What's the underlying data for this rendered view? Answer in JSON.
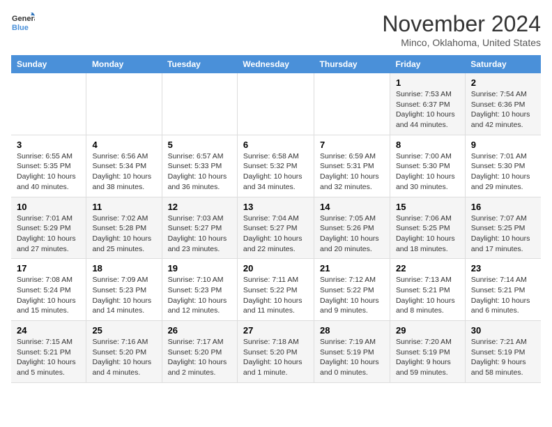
{
  "logo": {
    "general": "General",
    "blue": "Blue"
  },
  "title": "November 2024",
  "location": "Minco, Oklahoma, United States",
  "headers": [
    "Sunday",
    "Monday",
    "Tuesday",
    "Wednesday",
    "Thursday",
    "Friday",
    "Saturday"
  ],
  "weeks": [
    [
      {
        "day": "",
        "info": ""
      },
      {
        "day": "",
        "info": ""
      },
      {
        "day": "",
        "info": ""
      },
      {
        "day": "",
        "info": ""
      },
      {
        "day": "",
        "info": ""
      },
      {
        "day": "1",
        "info": "Sunrise: 7:53 AM\nSunset: 6:37 PM\nDaylight: 10 hours and 44 minutes."
      },
      {
        "day": "2",
        "info": "Sunrise: 7:54 AM\nSunset: 6:36 PM\nDaylight: 10 hours and 42 minutes."
      }
    ],
    [
      {
        "day": "3",
        "info": "Sunrise: 6:55 AM\nSunset: 5:35 PM\nDaylight: 10 hours and 40 minutes."
      },
      {
        "day": "4",
        "info": "Sunrise: 6:56 AM\nSunset: 5:34 PM\nDaylight: 10 hours and 38 minutes."
      },
      {
        "day": "5",
        "info": "Sunrise: 6:57 AM\nSunset: 5:33 PM\nDaylight: 10 hours and 36 minutes."
      },
      {
        "day": "6",
        "info": "Sunrise: 6:58 AM\nSunset: 5:32 PM\nDaylight: 10 hours and 34 minutes."
      },
      {
        "day": "7",
        "info": "Sunrise: 6:59 AM\nSunset: 5:31 PM\nDaylight: 10 hours and 32 minutes."
      },
      {
        "day": "8",
        "info": "Sunrise: 7:00 AM\nSunset: 5:30 PM\nDaylight: 10 hours and 30 minutes."
      },
      {
        "day": "9",
        "info": "Sunrise: 7:01 AM\nSunset: 5:30 PM\nDaylight: 10 hours and 29 minutes."
      }
    ],
    [
      {
        "day": "10",
        "info": "Sunrise: 7:01 AM\nSunset: 5:29 PM\nDaylight: 10 hours and 27 minutes."
      },
      {
        "day": "11",
        "info": "Sunrise: 7:02 AM\nSunset: 5:28 PM\nDaylight: 10 hours and 25 minutes."
      },
      {
        "day": "12",
        "info": "Sunrise: 7:03 AM\nSunset: 5:27 PM\nDaylight: 10 hours and 23 minutes."
      },
      {
        "day": "13",
        "info": "Sunrise: 7:04 AM\nSunset: 5:27 PM\nDaylight: 10 hours and 22 minutes."
      },
      {
        "day": "14",
        "info": "Sunrise: 7:05 AM\nSunset: 5:26 PM\nDaylight: 10 hours and 20 minutes."
      },
      {
        "day": "15",
        "info": "Sunrise: 7:06 AM\nSunset: 5:25 PM\nDaylight: 10 hours and 18 minutes."
      },
      {
        "day": "16",
        "info": "Sunrise: 7:07 AM\nSunset: 5:25 PM\nDaylight: 10 hours and 17 minutes."
      }
    ],
    [
      {
        "day": "17",
        "info": "Sunrise: 7:08 AM\nSunset: 5:24 PM\nDaylight: 10 hours and 15 minutes."
      },
      {
        "day": "18",
        "info": "Sunrise: 7:09 AM\nSunset: 5:23 PM\nDaylight: 10 hours and 14 minutes."
      },
      {
        "day": "19",
        "info": "Sunrise: 7:10 AM\nSunset: 5:23 PM\nDaylight: 10 hours and 12 minutes."
      },
      {
        "day": "20",
        "info": "Sunrise: 7:11 AM\nSunset: 5:22 PM\nDaylight: 10 hours and 11 minutes."
      },
      {
        "day": "21",
        "info": "Sunrise: 7:12 AM\nSunset: 5:22 PM\nDaylight: 10 hours and 9 minutes."
      },
      {
        "day": "22",
        "info": "Sunrise: 7:13 AM\nSunset: 5:21 PM\nDaylight: 10 hours and 8 minutes."
      },
      {
        "day": "23",
        "info": "Sunrise: 7:14 AM\nSunset: 5:21 PM\nDaylight: 10 hours and 6 minutes."
      }
    ],
    [
      {
        "day": "24",
        "info": "Sunrise: 7:15 AM\nSunset: 5:21 PM\nDaylight: 10 hours and 5 minutes."
      },
      {
        "day": "25",
        "info": "Sunrise: 7:16 AM\nSunset: 5:20 PM\nDaylight: 10 hours and 4 minutes."
      },
      {
        "day": "26",
        "info": "Sunrise: 7:17 AM\nSunset: 5:20 PM\nDaylight: 10 hours and 2 minutes."
      },
      {
        "day": "27",
        "info": "Sunrise: 7:18 AM\nSunset: 5:20 PM\nDaylight: 10 hours and 1 minute."
      },
      {
        "day": "28",
        "info": "Sunrise: 7:19 AM\nSunset: 5:19 PM\nDaylight: 10 hours and 0 minutes."
      },
      {
        "day": "29",
        "info": "Sunrise: 7:20 AM\nSunset: 5:19 PM\nDaylight: 9 hours and 59 minutes."
      },
      {
        "day": "30",
        "info": "Sunrise: 7:21 AM\nSunset: 5:19 PM\nDaylight: 9 hours and 58 minutes."
      }
    ]
  ]
}
